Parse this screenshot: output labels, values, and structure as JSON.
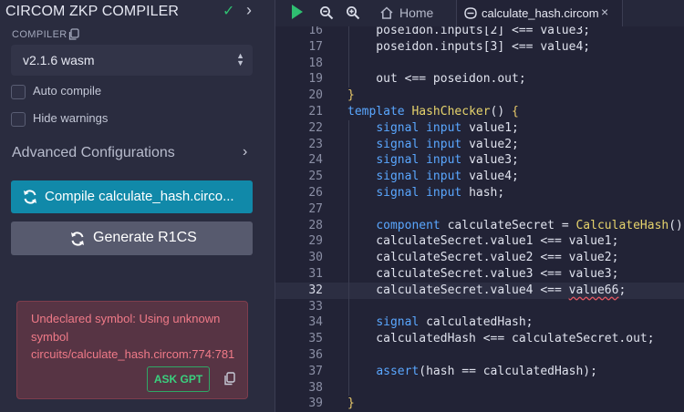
{
  "panel": {
    "title": "CIRCOM ZKP COMPILER",
    "compiler_label": "COMPILER",
    "compiler_version": "v2.1.6 wasm",
    "auto_compile_label": "Auto compile",
    "hide_warnings_label": "Hide warnings",
    "advanced_label": "Advanced Configurations",
    "compile_button": "Compile calculate_hash.circo...",
    "generate_button": "Generate R1CS",
    "error_message": "Undeclared symbol: Using unknown symbol circuits/calculate_hash.circom:774:781",
    "ask_gpt": "ASK GPT",
    "checkmark": "✓",
    "chevron": "›"
  },
  "topbar": {
    "home_tab": "Home",
    "file_tab": "calculate_hash.circom",
    "close": "×"
  },
  "colors": {
    "accent": "#1189a9",
    "success": "#2fbf71",
    "error_text": "#f07a88",
    "error_bg": "#573444",
    "keyword": "#5aa7ff",
    "function": "#e6d36c"
  },
  "editor": {
    "active_line": "32",
    "lines": [
      {
        "n": "16",
        "t": "    poseidon.inputs[2] <== value3;"
      },
      {
        "n": "17",
        "t": "    poseidon.inputs[3] <== value4;"
      },
      {
        "n": "18",
        "t": ""
      },
      {
        "n": "19",
        "t": "    out <== poseidon.out;"
      },
      {
        "n": "20",
        "t": "}"
      },
      {
        "n": "21",
        "t": "template HashChecker() {"
      },
      {
        "n": "22",
        "t": "    signal input value1;"
      },
      {
        "n": "23",
        "t": "    signal input value2;"
      },
      {
        "n": "24",
        "t": "    signal input value3;"
      },
      {
        "n": "25",
        "t": "    signal input value4;"
      },
      {
        "n": "26",
        "t": "    signal input hash;"
      },
      {
        "n": "27",
        "t": ""
      },
      {
        "n": "28",
        "t": "    component calculateSecret = CalculateHash();"
      },
      {
        "n": "29",
        "t": "    calculateSecret.value1 <== value1;"
      },
      {
        "n": "30",
        "t": "    calculateSecret.value2 <== value2;"
      },
      {
        "n": "31",
        "t": "    calculateSecret.value3 <== value3;"
      },
      {
        "n": "32",
        "t": "    calculateSecret.value4 <== value66;"
      },
      {
        "n": "33",
        "t": ""
      },
      {
        "n": "34",
        "t": "    signal calculatedHash;"
      },
      {
        "n": "35",
        "t": "    calculatedHash <== calculateSecret.out;"
      },
      {
        "n": "36",
        "t": ""
      },
      {
        "n": "37",
        "t": "    assert(hash == calculatedHash);"
      },
      {
        "n": "38",
        "t": ""
      },
      {
        "n": "39",
        "t": "}"
      }
    ]
  }
}
